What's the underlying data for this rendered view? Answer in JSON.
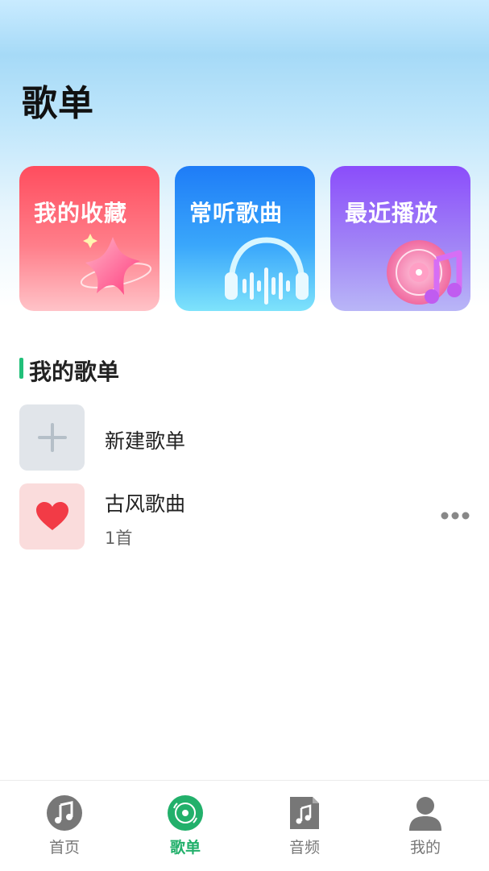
{
  "page": {
    "title": "歌单"
  },
  "cards": [
    {
      "label": "我的收藏",
      "icon": "star-icon"
    },
    {
      "label": "常听歌曲",
      "icon": "headphones-icon"
    },
    {
      "label": "最近播放",
      "icon": "record-music-icon"
    }
  ],
  "section": {
    "title": "我的歌单"
  },
  "playlists": {
    "new": {
      "label": "新建歌单",
      "icon": "plus-icon"
    },
    "items": [
      {
        "name": "古风歌曲",
        "count": "1首",
        "icon": "heart-icon"
      }
    ]
  },
  "tabbar": {
    "active": "歌单",
    "active_color": "#22b06b",
    "items": [
      {
        "label": "首页",
        "icon": "music-note-icon"
      },
      {
        "label": "歌单",
        "icon": "vinyl-icon"
      },
      {
        "label": "音频",
        "icon": "audio-file-icon"
      },
      {
        "label": "我的",
        "icon": "user-icon"
      }
    ]
  },
  "colors": {
    "accent": "#22c07a",
    "card_fav": "#ff4d5e",
    "card_freq": "#1e7cf7",
    "card_recent": "#8b4dfb"
  }
}
